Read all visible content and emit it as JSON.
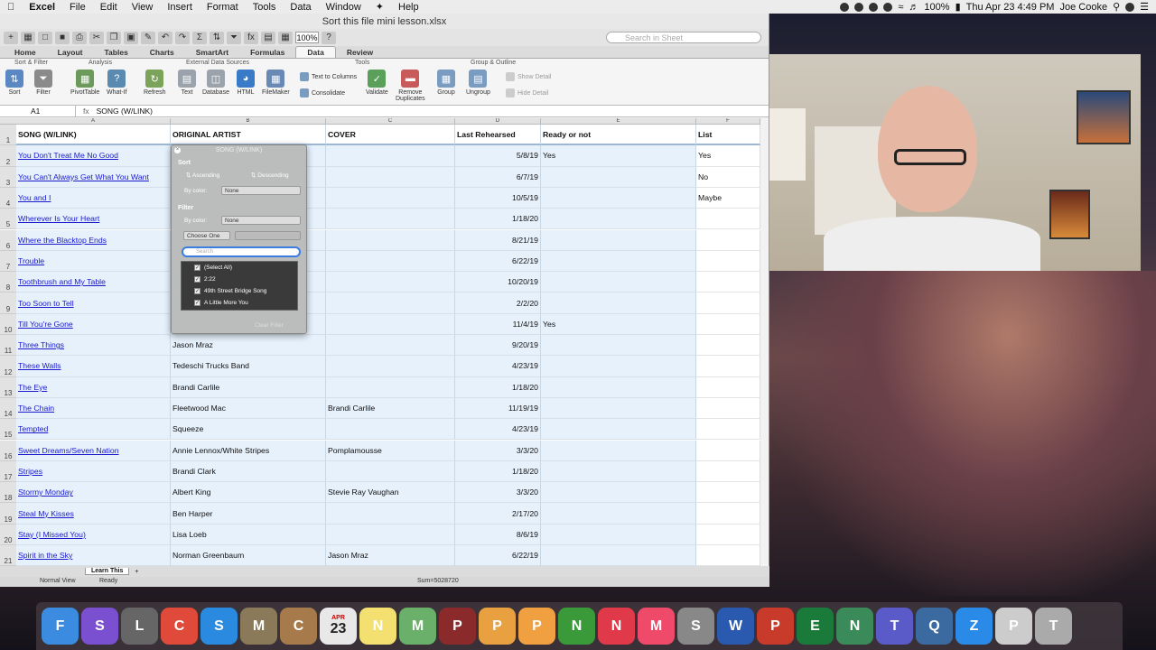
{
  "menubar": {
    "app": "Excel",
    "items": [
      "File",
      "Edit",
      "View",
      "Insert",
      "Format",
      "Tools",
      "Data",
      "Window",
      "Help"
    ],
    "battery": "100%",
    "clock": "Thu Apr 23  4:49 PM",
    "user": "Joe Cooke"
  },
  "window": {
    "title": "Sort this file mini lesson.xlsx",
    "zoom": "100%",
    "search_placeholder": "Search in Sheet"
  },
  "ribbon": {
    "tabs": [
      "Home",
      "Layout",
      "Tables",
      "Charts",
      "SmartArt",
      "Formulas",
      "Data",
      "Review"
    ],
    "active_tab": "Data",
    "groups": {
      "sort_filter": "Sort & Filter",
      "analysis": "Analysis",
      "external": "External Data Sources",
      "tools": "Tools",
      "group_outline": "Group & Outline"
    },
    "buttons": {
      "sort": "Sort",
      "filter": "Filter",
      "pivot": "PivotTable",
      "whatif": "What-If",
      "refresh": "Refresh",
      "text": "Text",
      "database": "Database",
      "html": "HTML",
      "filemaker": "FileMaker",
      "text_to_columns": "Text to Columns",
      "consolidate": "Consolidate",
      "validate": "Validate",
      "remove_dup": "Remove",
      "remove_dup2": "Duplicates",
      "group": "Group",
      "ungroup": "Ungroup",
      "show_detail": "Show Detail",
      "hide_detail": "Hide Detail"
    }
  },
  "formula": {
    "namebox": "A1",
    "fx": "fx",
    "content": "SONG (W/LINK)"
  },
  "columns": [
    "A",
    "B",
    "C",
    "D",
    "E",
    "F"
  ],
  "headers": [
    "SONG (W/LINK)",
    "ORIGINAL ARTIST",
    "COVER",
    "Last Rehearsed",
    "Ready or not",
    "List"
  ],
  "rows": [
    {
      "n": "2",
      "song": "You Don't Treat Me No Good",
      "artist": "",
      "cover": "",
      "date": "5/8/19",
      "ready": "Yes",
      "list": "Yes"
    },
    {
      "n": "3",
      "song": "You Can't Always Get What You Want",
      "artist": "",
      "cover": "",
      "date": "6/7/19",
      "ready": "",
      "list": "No"
    },
    {
      "n": "4",
      "song": "You and I",
      "artist": "",
      "cover": "",
      "date": "10/5/19",
      "ready": "",
      "list": "Maybe"
    },
    {
      "n": "5",
      "song": "Wherever Is Your Heart",
      "artist": "",
      "cover": "",
      "date": "1/18/20",
      "ready": "",
      "list": ""
    },
    {
      "n": "6",
      "song": "Where the Blacktop Ends",
      "artist": "",
      "cover": "",
      "date": "8/21/19",
      "ready": "",
      "list": ""
    },
    {
      "n": "7",
      "song": "Trouble",
      "artist": "",
      "cover": "",
      "date": "6/22/19",
      "ready": "",
      "list": ""
    },
    {
      "n": "8",
      "song": "Toothbrush and My Table",
      "artist": "",
      "cover": "",
      "date": "10/20/19",
      "ready": "",
      "list": ""
    },
    {
      "n": "9",
      "song": "Too Soon to Tell",
      "artist": "",
      "cover": "",
      "date": "2/2/20",
      "ready": "",
      "list": ""
    },
    {
      "n": "10",
      "song": "Till You're Gone",
      "artist": "",
      "cover": "",
      "date": "11/4/19",
      "ready": "Yes",
      "list": ""
    },
    {
      "n": "11",
      "song": "Three Things",
      "artist": "Jason Mraz",
      "cover": "",
      "date": "9/20/19",
      "ready": "",
      "list": ""
    },
    {
      "n": "12",
      "song": "These Walls",
      "artist": "Tedeschi Trucks Band",
      "cover": "",
      "date": "4/23/19",
      "ready": "",
      "list": ""
    },
    {
      "n": "13",
      "song": "The Eye",
      "artist": "Brandi Carlile",
      "cover": "",
      "date": "1/18/20",
      "ready": "",
      "list": ""
    },
    {
      "n": "14",
      "song": "The Chain",
      "artist": "Fleetwood Mac",
      "cover": "Brandi Carlile",
      "date": "11/19/19",
      "ready": "",
      "list": ""
    },
    {
      "n": "15",
      "song": "Tempted",
      "artist": "Squeeze",
      "cover": "",
      "date": "4/23/19",
      "ready": "",
      "list": ""
    },
    {
      "n": "16",
      "song": "Sweet Dreams/Seven Nation",
      "artist": "Annie Lennox/White Stripes",
      "cover": "Pomplamousse",
      "date": "3/3/20",
      "ready": "",
      "list": ""
    },
    {
      "n": "17",
      "song": "Stripes",
      "artist": "Brandi Clark",
      "cover": "",
      "date": "1/18/20",
      "ready": "",
      "list": ""
    },
    {
      "n": "18",
      "song": "Stormy Monday",
      "artist": "Albert King",
      "cover": "Stevie Ray Vaughan",
      "date": "3/3/20",
      "ready": "",
      "list": ""
    },
    {
      "n": "19",
      "song": "Steal My Kisses",
      "artist": "Ben Harper",
      "cover": "",
      "date": "2/17/20",
      "ready": "",
      "list": ""
    },
    {
      "n": "20",
      "song": "Stay (I Missed You)",
      "artist": "Lisa Loeb",
      "cover": "",
      "date": "8/6/19",
      "ready": "",
      "list": ""
    },
    {
      "n": "21",
      "song": "Spirit in the Sky",
      "artist": "Norman Greenbaum",
      "cover": "Jason Mraz",
      "date": "6/22/19",
      "ready": "",
      "list": ""
    }
  ],
  "popup": {
    "title": "SONG (W/LINK)",
    "sort": "Sort",
    "ascending": "Ascending",
    "descending": "Descending",
    "by_color": "By color:",
    "color_value": "None",
    "filter": "Filter",
    "by_color2": "By color:",
    "color_value2": "None",
    "choose": "Choose One",
    "search_placeholder": "Search",
    "list": [
      "(Select All)",
      "2:22",
      "49th Street Bridge Song",
      "A Little More You"
    ],
    "clear": "Clear Filter"
  },
  "sheet": {
    "tab": "Learn This",
    "add": "+"
  },
  "status": {
    "view": "Normal View",
    "ready": "Ready",
    "sum": "Sum=5028720"
  },
  "dock": [
    "Finder",
    "Siri",
    "Launchpad",
    "Chrome",
    "Safari",
    "Mail",
    "Contacts",
    "Calendar",
    "Notes",
    "Maps",
    "Photo Booth",
    "Photos",
    "Pages",
    "Numbers",
    "News",
    "Music",
    "System Preferences",
    "Word",
    "PowerPoint",
    "Excel",
    "Network",
    "Teams",
    "QuickTime",
    "Zoom",
    "Preview",
    "Trash"
  ],
  "dock_calendar": {
    "month": "APR",
    "day": "23"
  }
}
